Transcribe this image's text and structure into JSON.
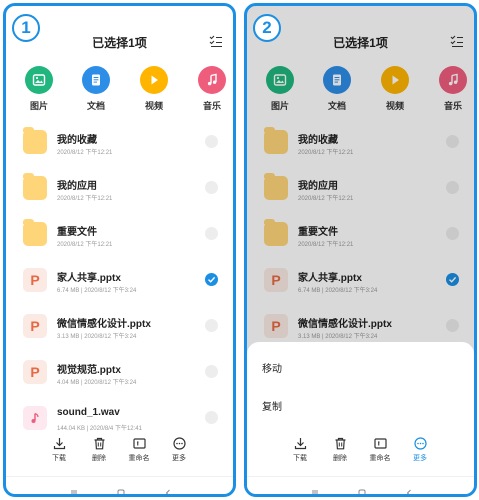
{
  "screen1": {
    "badge": "1",
    "title": "已选择1项"
  },
  "screen2": {
    "badge": "2",
    "title": "已选择1项"
  },
  "categories": [
    {
      "label": "图片",
      "icon": "image-icon",
      "color": "#20b67e"
    },
    {
      "label": "文档",
      "icon": "document-icon",
      "color": "#2d8ee8"
    },
    {
      "label": "视频",
      "icon": "video-play-icon",
      "color": "#ffb400"
    },
    {
      "label": "音乐",
      "icon": "music-note-icon",
      "color": "#ef5d7d"
    }
  ],
  "files": [
    {
      "name": "我的收藏",
      "meta": "2020/8/12 下午12:21",
      "type": "folder",
      "selected": false
    },
    {
      "name": "我的应用",
      "meta": "2020/8/12 下午12:21",
      "type": "folder",
      "selected": false
    },
    {
      "name": "重要文件",
      "meta": "2020/8/12 下午12:21",
      "type": "folder",
      "selected": false
    },
    {
      "name": "家人共享.pptx",
      "meta": "6.74 MB | 2020/8/12 下午3:24",
      "type": "ppt",
      "selected": true
    },
    {
      "name": "微信情感化设计.pptx",
      "meta": "3.13 MB | 2020/8/12 下午3:24",
      "type": "ppt",
      "selected": false
    },
    {
      "name": "视觉规范.pptx",
      "meta": "4.04 MB | 2020/8/12 下午3:24",
      "type": "ppt",
      "selected": false
    },
    {
      "name": "sound_1.wav",
      "meta": "144.04 KB | 2020/8/4 下午12:41",
      "type": "audio",
      "selected": false
    }
  ],
  "ppt_letter": "P",
  "toolbar": [
    {
      "label": "下载",
      "icon": "download-icon"
    },
    {
      "label": "删除",
      "icon": "trash-icon"
    },
    {
      "label": "重命名",
      "icon": "rename-icon"
    },
    {
      "label": "更多",
      "icon": "more-icon"
    }
  ],
  "sheet_menu": [
    {
      "label": "移动"
    },
    {
      "label": "复制"
    }
  ],
  "colors": {
    "accent": "#1a8fe3",
    "folder": "#ffd57a",
    "ppt": "#e56a44"
  }
}
